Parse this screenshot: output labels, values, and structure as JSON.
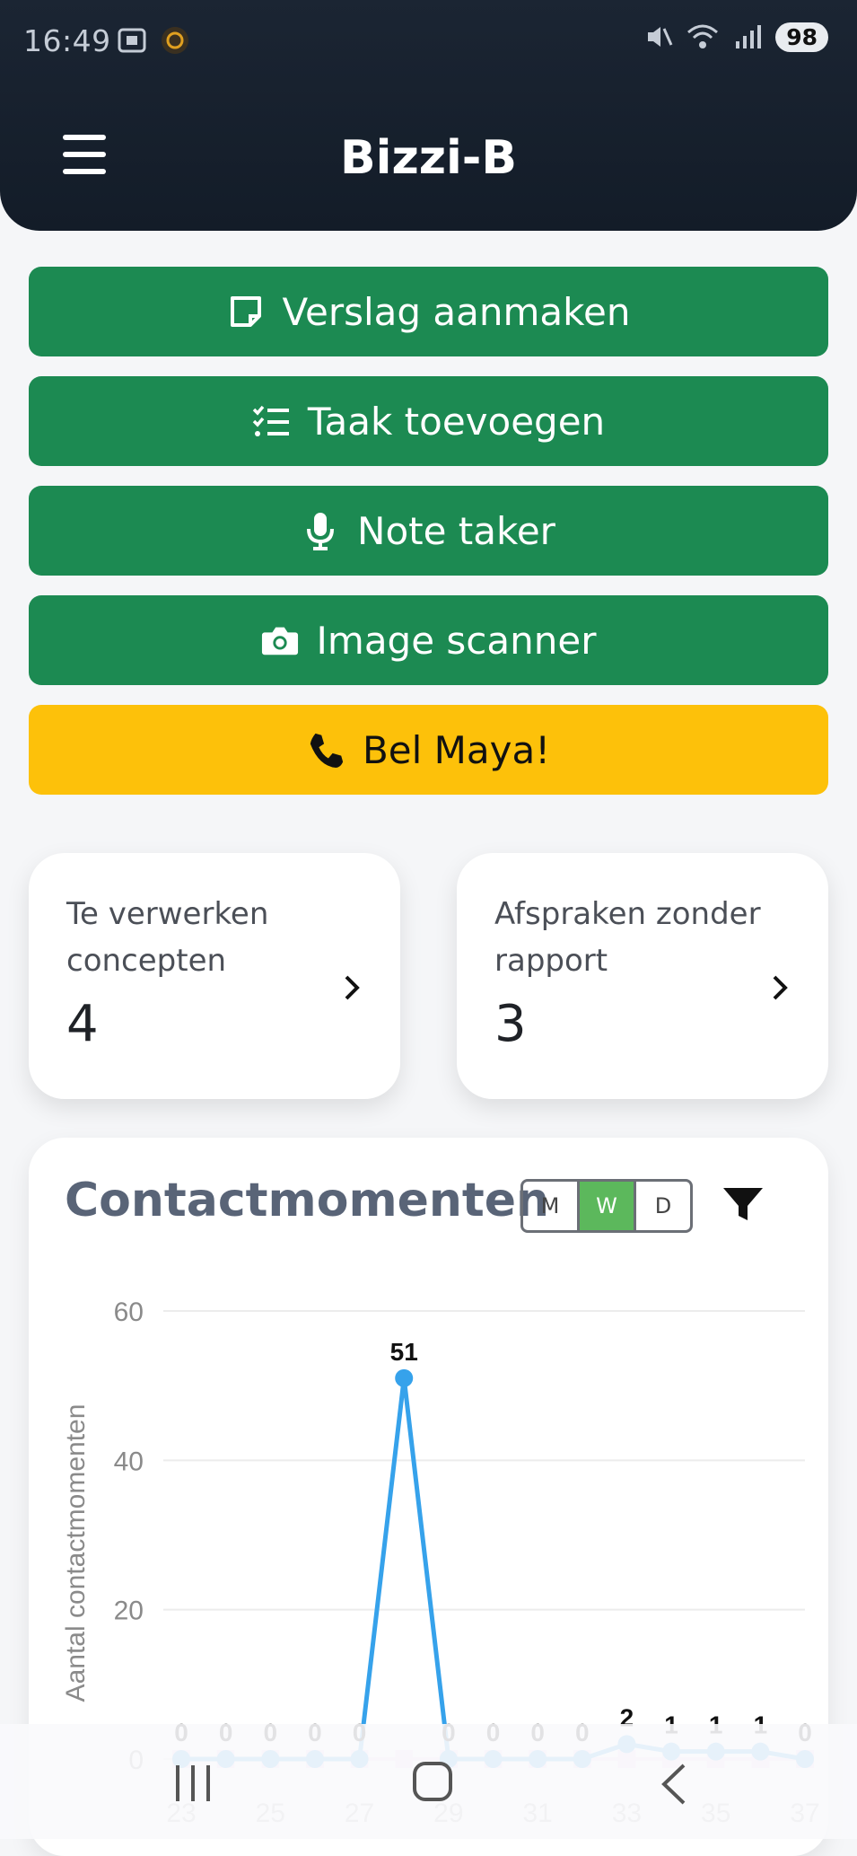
{
  "status": {
    "time": "16:49",
    "battery": "98"
  },
  "header": {
    "title": "Bizzi-B"
  },
  "actions": [
    {
      "label": "Verslag aanmaken",
      "icon": "note-icon",
      "color": "#1c8a52"
    },
    {
      "label": "Taak toevoegen",
      "icon": "checklist-icon",
      "color": "#1c8a52"
    },
    {
      "label": "Note taker",
      "icon": "microphone-icon",
      "color": "#1c8a52"
    },
    {
      "label": "Image scanner",
      "icon": "camera-icon",
      "color": "#1c8a52"
    },
    {
      "label": "Bel Maya!",
      "icon": "phone-icon",
      "color": "#fdc10a"
    }
  ],
  "cards": [
    {
      "label": "Te verwerken concepten",
      "count": "4"
    },
    {
      "label": "Afspraken zonder rapport",
      "count": "3"
    }
  ],
  "contact": {
    "title": "Contactmomenten",
    "periods": [
      "M",
      "W",
      "D"
    ],
    "selected_period": "W"
  },
  "chart_data": {
    "type": "line",
    "ylabel": "Aantal contactmomenten",
    "xlabel": "",
    "ylim": [
      0,
      60
    ],
    "y_ticks": [
      0,
      20,
      40,
      60
    ],
    "x_tick_labels": [
      "23",
      "25",
      "27",
      "29",
      "31",
      "33",
      "35",
      "37"
    ],
    "grid": true,
    "series": [
      {
        "x": [
          23,
          24,
          25,
          26,
          27,
          28,
          29,
          30,
          31,
          32,
          33,
          34,
          35,
          36,
          37
        ],
        "values": [
          0,
          0,
          0,
          0,
          0,
          51,
          0,
          0,
          0,
          0,
          2,
          1,
          1,
          1,
          0
        ],
        "color": "#36a2eb"
      },
      {
        "x": [
          23,
          24,
          25,
          26,
          27,
          28,
          29,
          30,
          31,
          32,
          33,
          34,
          35,
          36,
          37
        ],
        "values": [
          0,
          0,
          0,
          0,
          0,
          0,
          0,
          0,
          0,
          0,
          0,
          0,
          0,
          0,
          0
        ],
        "color": "#f3d6f3"
      }
    ]
  }
}
